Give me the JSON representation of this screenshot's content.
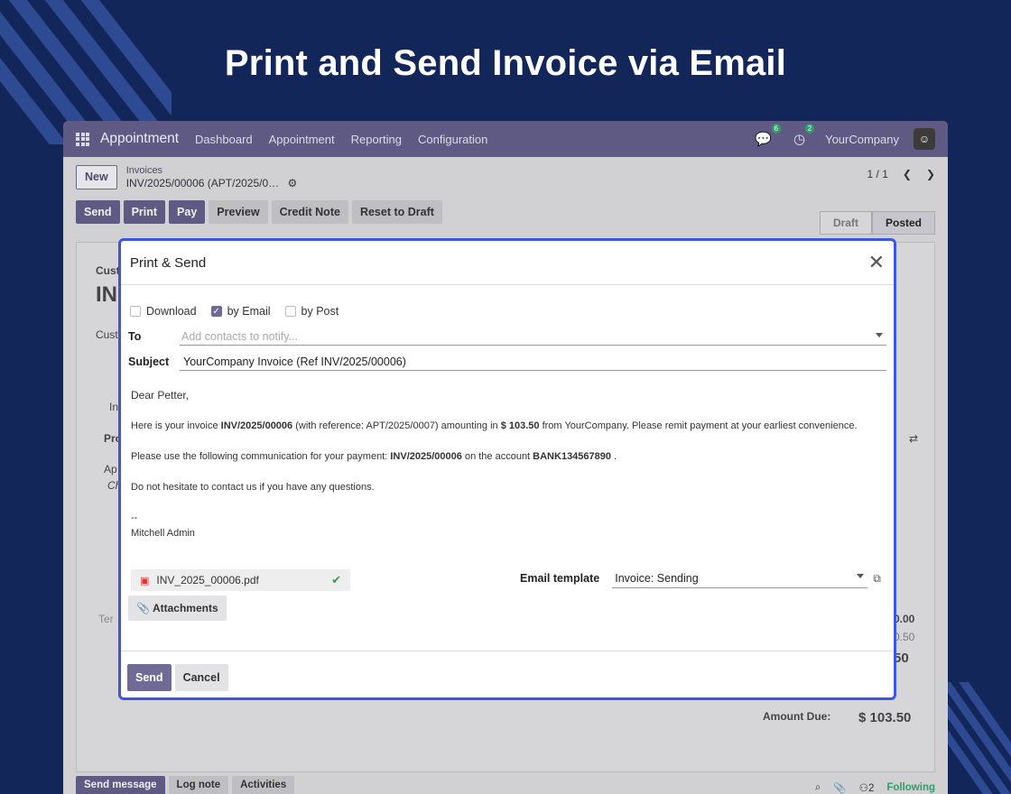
{
  "hero": {
    "title": "Print and Send Invoice via Email"
  },
  "navbar": {
    "app_name": "Appointment",
    "menu": [
      "Dashboard",
      "Appointment",
      "Reporting",
      "Configuration"
    ],
    "messages_count": "6",
    "activities_count": "2",
    "company": "YourCompany"
  },
  "breadcrumb": {
    "new_label": "New",
    "parent": "Invoices",
    "current": "INV/2025/00006 (APT/2025/0…",
    "pager": "1 / 1"
  },
  "toolbar": {
    "send": "Send",
    "print": "Print",
    "pay": "Pay",
    "preview": "Preview",
    "credit_note": "Credit Note",
    "reset": "Reset to Draft"
  },
  "status": {
    "draft": "Draft",
    "posted": "Posted"
  },
  "background": {
    "cust_label": "Cust",
    "inv_prefix": "IN",
    "cust_label2": "Cust",
    "tab_label": "In",
    "pro_label": "Pro",
    "ap_label": "Ap",
    "ch_label": "Ch",
    "ter_label": "Ter",
    "val1": "0.00",
    "val2": "0.50",
    "val3": "50",
    "amount_due_label": "Amount Due:",
    "amount_due": "$ 103.50"
  },
  "chatter": {
    "send_message": "Send message",
    "log_note": "Log note",
    "activities": "Activities",
    "followers": "2",
    "following": "Following"
  },
  "dialog": {
    "title": "Print & Send",
    "options": [
      {
        "label": "Download",
        "checked": false
      },
      {
        "label": "by Email",
        "checked": true
      },
      {
        "label": "by Post",
        "checked": false
      }
    ],
    "to_label": "To",
    "to_placeholder": "Add contacts to notify...",
    "subject_label": "Subject",
    "subject_value": "YourCompany Invoice (Ref INV/2025/00006)",
    "body": {
      "greeting": "Dear Petter,",
      "l1_a": "Here is your invoice ",
      "l1_inv": "INV/2025/00006",
      "l1_b": " (with reference: APT/2025/0007) amounting in ",
      "l1_amt": "$ 103.50",
      "l1_c": " from YourCompany. Please remit payment at your earliest convenience.",
      "l2_a": "Please use the following communication for your payment: ",
      "l2_inv": "INV/2025/00006",
      "l2_b": " on the account ",
      "l2_acct": "BANK134567890",
      "l2_c": " .",
      "l3": "Do not hesitate to contact us if you have any questions.",
      "sig_dash": "--",
      "sig_name": "Mitchell Admin"
    },
    "attachment_name": "INV_2025_00006.pdf",
    "attachments_button": "Attachments",
    "template_label": "Email template",
    "template_value": "Invoice: Sending",
    "send_button": "Send",
    "cancel_button": "Cancel"
  }
}
